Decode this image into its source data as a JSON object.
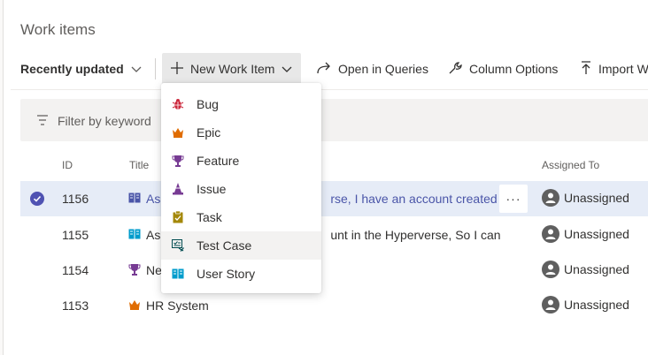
{
  "page": {
    "title": "Work items"
  },
  "toolbar": {
    "recently_updated": "Recently updated",
    "new_work_item": "New Work Item",
    "open_in_queries": "Open in Queries",
    "column_options": "Column Options",
    "import": "Import W"
  },
  "filter": {
    "placeholder": "Filter by keyword"
  },
  "columns": {
    "id": "ID",
    "title": "Title",
    "assigned_to": "Assigned To"
  },
  "rows": [
    {
      "id": "1156",
      "type": "user-story",
      "title_left": "As",
      "title_right": "rse, I have an account created in A",
      "assigned": "Unassigned",
      "selected": true
    },
    {
      "id": "1155",
      "type": "user-story",
      "title_left": "As",
      "title_right": "unt in the Hyperverse, So I can be prov",
      "assigned": "Unassigned"
    },
    {
      "id": "1154",
      "type": "feature",
      "title_left": "Ne",
      "title_right": "",
      "assigned": "Unassigned"
    },
    {
      "id": "1153",
      "type": "epic",
      "title_left": "HR System",
      "title_right": "",
      "assigned": "Unassigned"
    }
  ],
  "menu": {
    "items": [
      {
        "label": "Bug",
        "icon": "bug-icon",
        "color": "#cc293d"
      },
      {
        "label": "Epic",
        "icon": "crown-icon",
        "color": "#e06c00"
      },
      {
        "label": "Feature",
        "icon": "trophy-icon",
        "color": "#773b93"
      },
      {
        "label": "Issue",
        "icon": "cone-icon",
        "color": "#773b93"
      },
      {
        "label": "Task",
        "icon": "clipboard-icon",
        "color": "#a4880a"
      },
      {
        "label": "Test Case",
        "icon": "test-case-icon",
        "color": "#004b50"
      },
      {
        "label": "User Story",
        "icon": "book-icon",
        "color": "#009ccc"
      }
    ]
  },
  "colors": {
    "accent": "#4f52b2",
    "selected_row": "#e6ecf7",
    "selected_text": "#4a55a8",
    "menu_hover": "#f3f2f1"
  }
}
